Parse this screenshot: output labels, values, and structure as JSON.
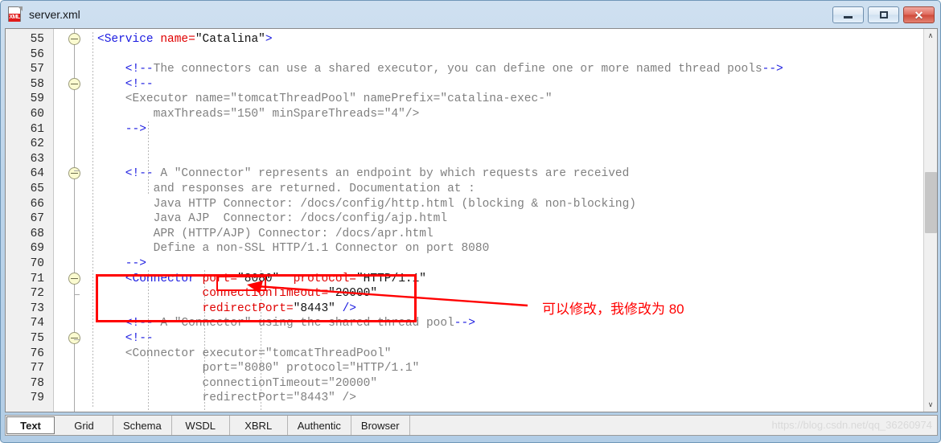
{
  "window": {
    "title": "server.xml",
    "icon": "xml-file-icon",
    "badge_text": "XML",
    "controls": {
      "minimize": "minimize-button",
      "maximize": "maximize-button",
      "close": "✕"
    }
  },
  "editor": {
    "first_line": 55,
    "lines": [
      {
        "n": 55,
        "fold": true,
        "segs": [
          {
            "t": "tag",
            "s": "<Service "
          },
          {
            "t": "attr",
            "s": "name="
          },
          {
            "t": "val",
            "s": "\"Catalina\""
          },
          {
            "t": "tag",
            "s": ">"
          }
        ]
      },
      {
        "n": 56,
        "fold": false,
        "segs": []
      },
      {
        "n": 57,
        "fold": false,
        "segs": [
          {
            "t": "punc",
            "s": "    <!--"
          },
          {
            "t": "comment",
            "s": "The connectors can use a shared executor, you can define one or more named thread pools"
          },
          {
            "t": "punc",
            "s": "-->"
          }
        ]
      },
      {
        "n": 58,
        "fold": true,
        "segs": [
          {
            "t": "punc",
            "s": "    <!--"
          }
        ]
      },
      {
        "n": 59,
        "fold": false,
        "segs": [
          {
            "t": "comment",
            "s": "    <Executor name=\"tomcatThreadPool\" namePrefix=\"catalina-exec-\""
          }
        ]
      },
      {
        "n": 60,
        "fold": false,
        "segs": [
          {
            "t": "comment",
            "s": "        maxThreads=\"150\" minSpareThreads=\"4\"/>"
          }
        ]
      },
      {
        "n": 61,
        "fold": false,
        "segs": [
          {
            "t": "punc",
            "s": "    -->"
          }
        ]
      },
      {
        "n": 62,
        "fold": false,
        "segs": []
      },
      {
        "n": 63,
        "fold": false,
        "segs": []
      },
      {
        "n": 64,
        "fold": true,
        "segs": [
          {
            "t": "punc",
            "s": "    <!--"
          },
          {
            "t": "comment",
            "s": " A \"Connector\" represents an endpoint by which requests are received"
          }
        ]
      },
      {
        "n": 65,
        "fold": false,
        "segs": [
          {
            "t": "comment",
            "s": "        and responses are returned. Documentation at :"
          }
        ]
      },
      {
        "n": 66,
        "fold": false,
        "segs": [
          {
            "t": "comment",
            "s": "        Java HTTP Connector: /docs/config/http.html (blocking & non-blocking)"
          }
        ]
      },
      {
        "n": 67,
        "fold": false,
        "segs": [
          {
            "t": "comment",
            "s": "        Java AJP  Connector: /docs/config/ajp.html"
          }
        ]
      },
      {
        "n": 68,
        "fold": false,
        "segs": [
          {
            "t": "comment",
            "s": "        APR (HTTP/AJP) Connector: /docs/apr.html"
          }
        ]
      },
      {
        "n": 69,
        "fold": false,
        "segs": [
          {
            "t": "comment",
            "s": "        Define a non-SSL HTTP/1.1 Connector on port 8080"
          }
        ]
      },
      {
        "n": 70,
        "fold": false,
        "segs": [
          {
            "t": "punc",
            "s": "    -->"
          }
        ]
      },
      {
        "n": 71,
        "fold": true,
        "segs": [
          {
            "t": "tag",
            "s": "    <Connector "
          },
          {
            "t": "attr",
            "s": "port="
          },
          {
            "t": "val",
            "s": "\"8080\""
          },
          {
            "t": "attr",
            "s": "  protocol="
          },
          {
            "t": "val",
            "s": "\"HTTP/1.1\""
          }
        ]
      },
      {
        "n": 72,
        "fold": false,
        "segs": [
          {
            "t": "attr",
            "s": "               connectionTimeout="
          },
          {
            "t": "val",
            "s": "\"20000\""
          }
        ]
      },
      {
        "n": 73,
        "fold": false,
        "segs": [
          {
            "t": "attr",
            "s": "               redirectPort="
          },
          {
            "t": "val",
            "s": "\"8443\" "
          },
          {
            "t": "tag",
            "s": "/>"
          }
        ]
      },
      {
        "n": 74,
        "fold": false,
        "segs": [
          {
            "t": "punc",
            "s": "    <!--"
          },
          {
            "t": "comment",
            "s": " A \"Connector\" using the shared thread pool"
          },
          {
            "t": "punc",
            "s": "-->"
          }
        ]
      },
      {
        "n": 75,
        "fold": true,
        "segs": [
          {
            "t": "punc",
            "s": "    <!--"
          }
        ]
      },
      {
        "n": 76,
        "fold": false,
        "segs": [
          {
            "t": "comment",
            "s": "    <Connector executor=\"tomcatThreadPool\""
          }
        ]
      },
      {
        "n": 77,
        "fold": false,
        "segs": [
          {
            "t": "comment",
            "s": "               port=\"8080\" protocol=\"HTTP/1.1\""
          }
        ]
      },
      {
        "n": 78,
        "fold": false,
        "segs": [
          {
            "t": "comment",
            "s": "               connectionTimeout=\"20000\""
          }
        ]
      },
      {
        "n": 79,
        "fold": false,
        "segs": [
          {
            "t": "comment",
            "s": "               redirectPort=\"8443\" />"
          }
        ]
      }
    ]
  },
  "annotation": {
    "text": "可以修改，我修改为 80",
    "color": "#ff0000",
    "highlight_value": "8080"
  },
  "tabs": [
    {
      "label": "Text",
      "active": true
    },
    {
      "label": "Grid",
      "active": false
    },
    {
      "label": "Schema",
      "active": false
    },
    {
      "label": "WSDL",
      "active": false
    },
    {
      "label": "XBRL",
      "active": false
    },
    {
      "label": "Authentic",
      "active": false
    },
    {
      "label": "Browser",
      "active": false
    }
  ],
  "watermark": "https://blog.csdn.net/qq_36260974",
  "scrollbar": {
    "up_glyph": "∧",
    "down_glyph": "∨"
  }
}
